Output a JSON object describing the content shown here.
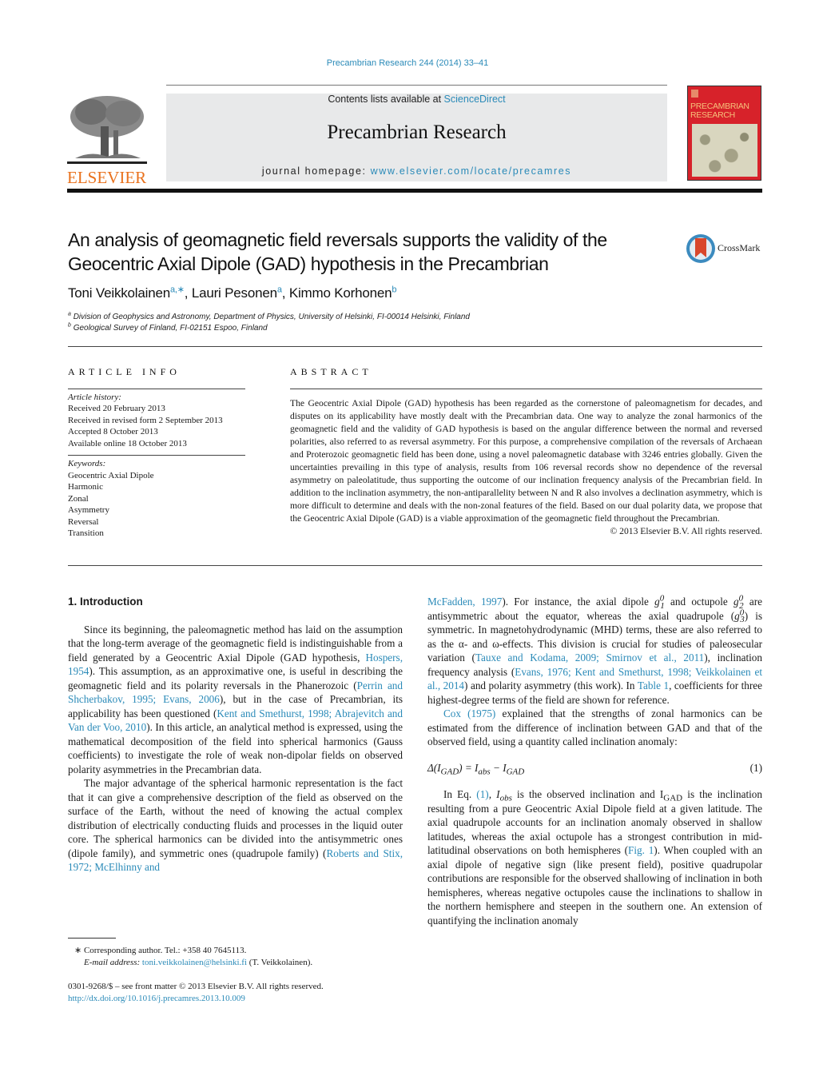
{
  "header": {
    "journal_ref": "Precambrian Research 244 (2014) 33–41",
    "contents_prefix": "Contents lists available at ",
    "contents_link": "ScienceDirect",
    "journal_name": "Precambrian Research",
    "homepage_prefix": "journal homepage: ",
    "homepage_url": "www.elsevier.com/locate/precamres",
    "publisher_logo": "ELSEVIER",
    "cover_title_line1": "PRECAMBRIAN",
    "cover_title_line2": "RESEARCH",
    "crossmark_label": "CrossMark"
  },
  "article": {
    "title_line1": "An analysis of geomagnetic field reversals supports the validity of the",
    "title_line2": "Geocentric Axial Dipole (GAD) hypothesis in the Precambrian",
    "authors": [
      {
        "name": "Toni Veikkolainen",
        "sup": "a,∗"
      },
      {
        "name": "Lauri Pesonen",
        "sup": "a"
      },
      {
        "name": "Kimmo Korhonen",
        "sup": "b"
      }
    ],
    "affiliations": [
      {
        "sup": "a",
        "text": "Division of Geophysics and Astronomy, Department of Physics, University of Helsinki, FI-00014 Helsinki, Finland"
      },
      {
        "sup": "b",
        "text": "Geological Survey of Finland, FI-02151 Espoo, Finland"
      }
    ]
  },
  "article_info": {
    "heading": "ARTICLE INFO",
    "history_label": "Article history:",
    "history": [
      "Received 20 February 2013",
      "Received in revised form 2 September 2013",
      "Accepted 8 October 2013",
      "Available online 18 October 2013"
    ],
    "keywords_label": "Keywords:",
    "keywords": [
      "Geocentric Axial Dipole",
      "Harmonic",
      "Zonal",
      "Asymmetry",
      "Reversal",
      "Transition"
    ]
  },
  "abstract": {
    "heading": "ABSTRACT",
    "text": "The Geocentric Axial Dipole (GAD) hypothesis has been regarded as the cornerstone of paleomagnetism for decades, and disputes on its applicability have mostly dealt with the Precambrian data. One way to analyze the zonal harmonics of the geomagnetic field and the validity of GAD hypothesis is based on the angular difference between the normal and reversed polarities, also referred to as reversal asymmetry. For this purpose, a comprehensive compilation of the reversals of Archaean and Proterozoic geomagnetic field has been done, using a novel paleomagnetic database with 3246 entries globally. Given the uncertainties prevailing in this type of analysis, results from 106 reversal records show no dependence of the reversal asymmetry on paleolatitude, thus supporting the outcome of our inclination frequency analysis of the Precambrian field. In addition to the inclination asymmetry, the non-antiparallelity between N and R also involves a declination asymmetry, which is more difficult to determine and deals with the non-zonal features of the field. Based on our dual polarity data, we propose that the Geocentric Axial Dipole (GAD) is a viable approximation of the geomagnetic field throughout the Precambrian.",
    "copyright": "© 2013 Elsevier B.V. All rights reserved."
  },
  "body": {
    "section_heading": "1.  Introduction",
    "p1": [
      "Since its beginning, the paleomagnetic method has laid on the assumption that the long-term average of the geomagnetic field is indistinguishable from a field generated by a Geocentric Axial Dipole (GAD hypothesis, ",
      "Hospers, 1954",
      "). This assumption, as an approximative one, is useful in describing the geomagnetic field and its polarity reversals in the Phanerozoic (",
      "Perrin and Shcherbakov, 1995; Evans, 2006",
      "), but in the case of Precambrian, its applicability has been questioned (",
      "Kent and Smethurst, 1998; Abrajevitch and Van der Voo, 2010",
      "). In this article, an analytical method is expressed, using the mathematical decomposition of the field into spherical harmonics (Gauss coefficients) to investigate the role of weak non-dipolar fields on observed polarity asymmetries in the Precambrian data."
    ],
    "p2": [
      "The major advantage of the spherical harmonic representation is the fact that it can give a comprehensive description of the field as observed on the surface of the Earth, without the need of knowing the actual complex distribution of electrically conducting fluids and processes in the liquid outer core. The spherical harmonics can be divided into the antisymmetric ones (dipole family), and symmetric ones (quadrupole family) (",
      "Roberts and Stix, 1972; McElhinny and"
    ],
    "p3": [
      "McFadden, 1997",
      "). For instance, the axial dipole ",
      " and octupole ",
      " are antisymmetric about the equator, whereas the axial quadrupole (",
      ") is symmetric. In magnetohydrodynamic (MHD) terms, these are also referred to as the α- and ω-effects. This division is crucial for studies of paleosecular variation (",
      "Tauxe and Kodama, 2009; Smirnov et al., 2011",
      "), inclination frequency analysis (",
      "Evans, 1976; Kent and Smethurst, 1998; Veikkolainen et al., 2014",
      ") and polarity asymmetry (this work). In ",
      "Table 1",
      ", coefficients for three highest-degree terms of the field are shown for reference."
    ],
    "p4": [
      "Cox (1975)",
      " explained that the strengths of zonal harmonics can be estimated from the difference of inclination between GAD and that of the observed field, using a quantity called inclination anomaly:"
    ],
    "equation": {
      "lhs": "Δ(I",
      "lhs_sub": "GAD",
      "mid": ") = I",
      "mid_sub": "abs",
      "rhs": " − I",
      "rhs_sub": "GAD",
      "number": "(1)"
    },
    "p5": [
      "In Eq. ",
      "(1)",
      ", I",
      "obs",
      " is the observed inclination and I",
      "GAD",
      " is the inclination resulting from a pure Geocentric Axial Dipole field at a given latitude. The axial quadrupole accounts for an inclination anomaly observed in shallow latitudes, whereas the axial octupole has a strongest contribution in mid-latitudinal observations on both hemispheres (",
      "Fig. 1",
      "). When coupled with an axial dipole of negative sign (like present field), positive quadrupolar contributions are responsible for the observed shallowing of inclination in both hemispheres, whereas negative octupoles cause the inclinations to shallow in the northern hemisphere and steepen in the southern one. An extension of quantifying the inclination anomaly"
    ],
    "gauss": {
      "g": "g",
      "sup": "0",
      "sub1": "1",
      "sub2": "2",
      "sub3": "3"
    }
  },
  "footnotes": {
    "corresponding": "∗  Corresponding author. Tel.: +358 40 7645113.",
    "email_label": "E-mail address: ",
    "email": "toni.veikkolainen@helsinki.fi",
    "email_suffix": " (T. Veikkolainen).",
    "issn": "0301-9268/$ – see front matter © 2013 Elsevier B.V. All rights reserved.",
    "doi": "http://dx.doi.org/10.1016/j.precamres.2013.10.009"
  },
  "colors": {
    "link": "#2a8ab8",
    "elsevier_orange": "#e9711c",
    "cover_red": "#d7222a",
    "banner_gray": "#e8e9ea"
  }
}
